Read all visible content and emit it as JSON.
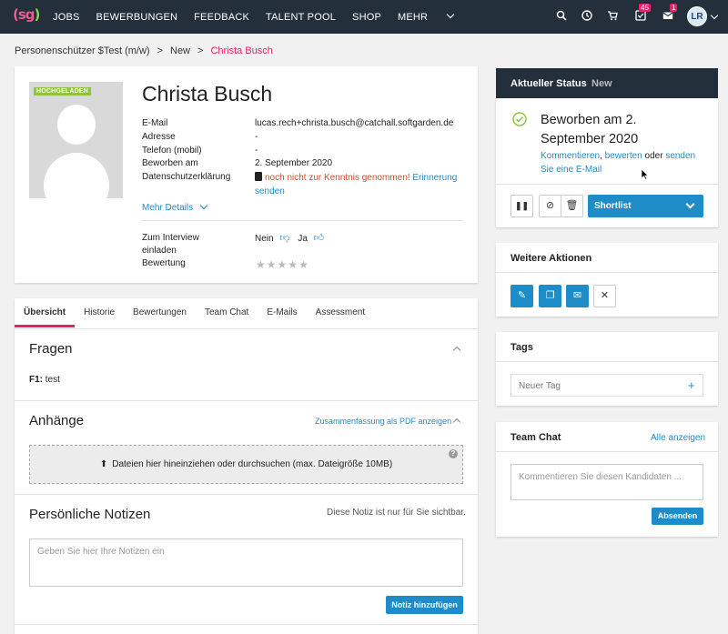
{
  "topbar": {
    "logo": "sg",
    "nav": [
      "JOBS",
      "BEWERBUNGEN",
      "FEEDBACK",
      "TALENT POOL",
      "SHOP",
      "MEHR"
    ],
    "tasks_badge": "45",
    "mail_badge": "1",
    "avatar_initials": "LR"
  },
  "breadcrumb": {
    "job": "Personenschützer $Test (m/w)",
    "stage": "New",
    "candidate": "Christa Busch"
  },
  "profile": {
    "uploaded_tag": "HOCHGELADEN",
    "name": "Christa Busch",
    "labels": {
      "email": "E-Mail",
      "address": "Adresse",
      "phone": "Telefon (mobil)",
      "applied": "Beworben am",
      "privacy": "Datenschutzerklärung",
      "interview": "Zum Interview einladen",
      "rating": "Bewertung"
    },
    "values": {
      "email": "lucas.rech+christa.busch@catchall.softgarden.de",
      "address": "-",
      "phone": "-",
      "applied": "2. September 2020",
      "privacy_status": "noch nicht zur Kenntnis genommen!",
      "privacy_link": "Erinnerung senden",
      "interview_no": "Nein",
      "interview_yes": "Ja"
    },
    "more_details": "Mehr Details",
    "rating_value": 0,
    "rating_max": 5
  },
  "tabs": [
    "Übersicht",
    "Historie",
    "Bewertungen",
    "Team Chat",
    "E-Mails",
    "Assessment"
  ],
  "fragen": {
    "title": "Fragen",
    "question_label": "F1:",
    "question_value": "test"
  },
  "anhaenge": {
    "title": "Anhänge",
    "pdf_link": "Zusammenfassung als PDF anzeigen",
    "drop_text": "Dateien hier hineinziehen oder durchsuchen (max. Dateigröße 10MB)"
  },
  "notizen": {
    "title": "Persönliche Notizen",
    "hint": "Diese Notiz ist nur für Sie sichtbar.",
    "placeholder": "Geben Sie hier Ihre Notizen ein",
    "button": "Notiz hinzufügen"
  },
  "status": {
    "header": "Aktueller Status",
    "stage": "New",
    "applied_text": "Beworben am 2. September 2020",
    "comment_link": "Kommentieren",
    "rate_link": "bewerten",
    "or_text": "oder",
    "email_link": "senden Sie eine E-Mail",
    "shortlist": "Shortlist"
  },
  "actions": {
    "title": "Weitere Aktionen"
  },
  "tags": {
    "title": "Tags",
    "new_tag": "Neuer Tag"
  },
  "teamchat": {
    "title": "Team Chat",
    "show_all": "Alle anzeigen",
    "placeholder": "Kommentieren Sie diesen Kandidaten ...",
    "send": "Absenden"
  },
  "colors": {
    "topbar": "#232f3b",
    "accent_pink": "#e6236a",
    "link_blue": "#1d8cc8",
    "warn_red": "#d9472b",
    "success_green": "#8fc43e"
  }
}
